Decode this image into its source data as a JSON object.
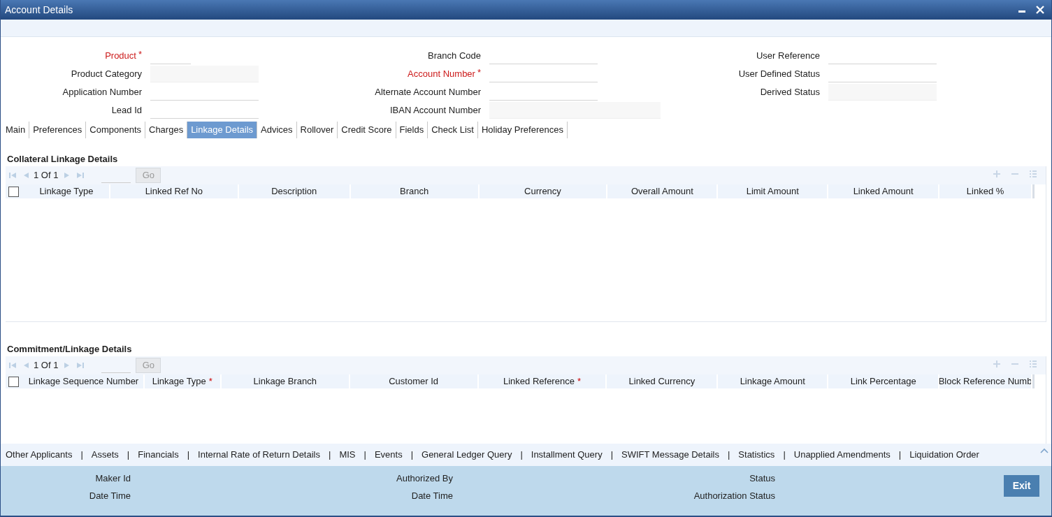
{
  "window": {
    "title": "Account Details"
  },
  "form": {
    "columns": [
      [
        {
          "label": "Product",
          "required": true,
          "kind": "short"
        },
        {
          "label": "Product Category",
          "required": false,
          "kind": "readonly"
        },
        {
          "label": "Application Number",
          "required": false,
          "kind": "line"
        },
        {
          "label": "Lead Id",
          "required": false,
          "kind": "line"
        }
      ],
      [
        {
          "label": "Branch Code",
          "required": false,
          "kind": "line"
        },
        {
          "label": "Account Number",
          "required": true,
          "kind": "line"
        },
        {
          "label": "Alternate Account Number",
          "required": false,
          "kind": "line"
        },
        {
          "label": "IBAN Account Number",
          "required": false,
          "kind": "wide"
        }
      ],
      [
        {
          "label": "User Reference",
          "required": false,
          "kind": "line"
        },
        {
          "label": "User Defined Status",
          "required": false,
          "kind": "line"
        },
        {
          "label": "Derived Status",
          "required": false,
          "kind": "readonly"
        }
      ]
    ]
  },
  "tabs": [
    {
      "label": "Main",
      "selected": false
    },
    {
      "label": "Preferences",
      "selected": false
    },
    {
      "label": "Components",
      "selected": false
    },
    {
      "label": "Charges",
      "selected": false
    },
    {
      "label": "Linkage Details",
      "selected": true
    },
    {
      "label": "Advices",
      "selected": false
    },
    {
      "label": "Rollover",
      "selected": false
    },
    {
      "label": "Credit Score",
      "selected": false
    },
    {
      "label": "Fields",
      "selected": false
    },
    {
      "label": "Check List",
      "selected": false
    },
    {
      "label": "Holiday Preferences",
      "selected": false
    }
  ],
  "grids": [
    {
      "title": "Collateral Linkage Details",
      "all_checked": false,
      "page": "1 Of 1",
      "go": "Go",
      "columns": [
        {
          "label": "Linkage Type",
          "required": false
        },
        {
          "label": "Linked Ref No",
          "required": false
        },
        {
          "label": "Description",
          "required": false
        },
        {
          "label": "Branch",
          "required": false
        },
        {
          "label": "Currency",
          "required": false
        },
        {
          "label": "Overall Amount",
          "required": false
        },
        {
          "label": "Limit Amount",
          "required": false
        },
        {
          "label": "Linked Amount",
          "required": false
        },
        {
          "label": "Linked %",
          "required": false
        }
      ]
    },
    {
      "title": "Commitment/Linkage Details",
      "all_checked": false,
      "page": "1 Of 1",
      "go": "Go",
      "columns": [
        {
          "label": "Linkage Sequence Number",
          "required": false
        },
        {
          "label": "Linkage Type",
          "required": true
        },
        {
          "label": "Linkage Branch",
          "required": false
        },
        {
          "label": "Customer Id",
          "required": false
        },
        {
          "label": "Linked Reference",
          "required": true
        },
        {
          "label": "Linked Currency",
          "required": false
        },
        {
          "label": "Linkage Amount",
          "required": false
        },
        {
          "label": "Link Percentage",
          "required": false
        },
        {
          "label": "Block Reference Numb",
          "required": false
        }
      ]
    }
  ],
  "required_mark": "*",
  "links": [
    "Other Applicants",
    "Assets",
    "Financials",
    "Internal Rate of Return Details",
    "MIS",
    "Events",
    "General Ledger Query",
    "Installment Query",
    "SWIFT Message Details",
    "Statistics",
    "Unapplied Amendments",
    "Liquidation Order"
  ],
  "link_separator": "|",
  "footer": {
    "columns": [
      [
        "Maker Id",
        "Date Time"
      ],
      [
        "Authorized By",
        "Date Time"
      ],
      [
        "Status",
        "Authorization Status"
      ]
    ],
    "exit": "Exit"
  }
}
